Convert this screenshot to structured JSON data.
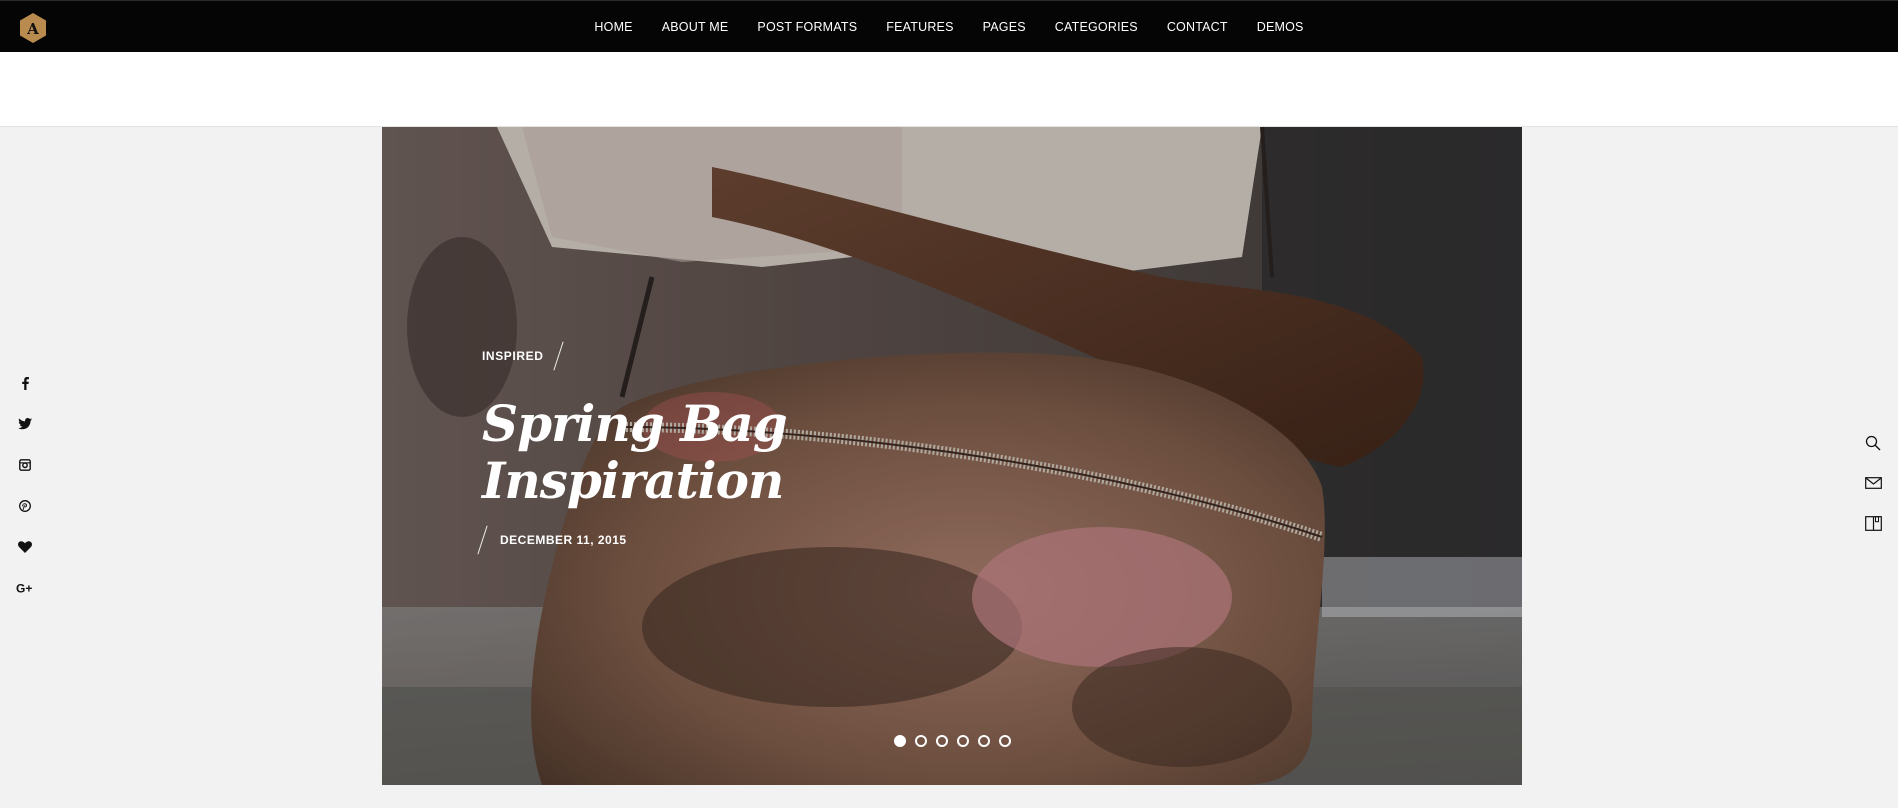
{
  "header": {
    "logo_letter": "A",
    "logo_color": "#b98b4e",
    "nav": [
      "HOME",
      "ABOUT ME",
      "POST FORMATS",
      "FEATURES",
      "PAGES",
      "CATEGORIES",
      "CONTACT",
      "DEMOS"
    ]
  },
  "social": [
    "facebook-icon",
    "twitter-icon",
    "instagram-icon",
    "pinterest-icon",
    "heart-icon",
    "google-plus-icon"
  ],
  "tools": [
    "search-icon",
    "mail-icon",
    "book-icon"
  ],
  "slider": {
    "category": "INSPIRED",
    "title_line1": "Spring Bag",
    "title_line2": "Inspiration",
    "date": "DECEMBER 11, 2015",
    "slide_count": 6,
    "active_slide": 1
  }
}
